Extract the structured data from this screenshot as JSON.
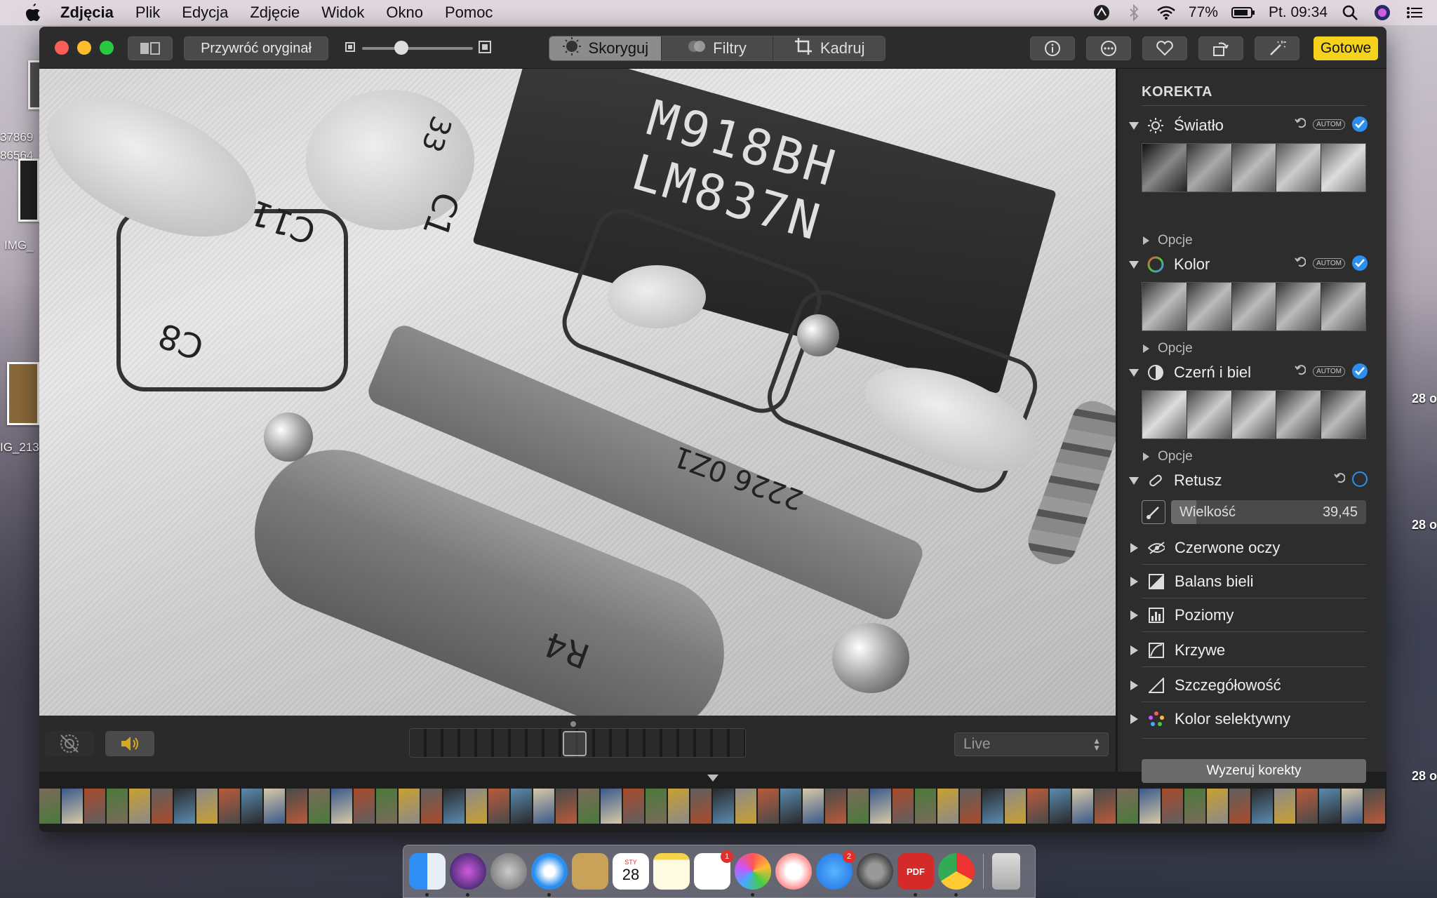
{
  "menubar": {
    "app_name": "Zdjęcia",
    "items": [
      "Plik",
      "Edycja",
      "Zdjęcie",
      "Widok",
      "Okno",
      "Pomoc"
    ],
    "battery": "77%",
    "clock": "Pt. 09:34"
  },
  "desktop": {
    "labels": [
      "37869",
      "86564",
      "IMG_",
      "IG_213"
    ],
    "right_labels": [
      "28 o",
      "28 o",
      "28 o"
    ]
  },
  "toolbar": {
    "revert_label": "Przywróć oryginał",
    "tabs": [
      {
        "label": "Skoryguj",
        "active": true,
        "icon": "adjust-icon"
      },
      {
        "label": "Filtry",
        "active": false,
        "icon": "filters-icon"
      },
      {
        "label": "Kadruj",
        "active": false,
        "icon": "crop-icon"
      }
    ],
    "done_label": "Gotowe"
  },
  "photo": {
    "chip_line1": "M918BH",
    "chip_line2": "LM837N",
    "silk_c8": "C8",
    "silk_r4": "R4",
    "silk_c11": "C11",
    "silk_c1": "C1",
    "resistor_text": "2226 0Z1",
    "cap_value": "33"
  },
  "video_bar": {
    "live_label": "Live"
  },
  "panel": {
    "title": "KOREKTA",
    "autom": "AUTOM",
    "options_label": "Opcje",
    "sections": [
      {
        "label": "Światło",
        "icon": "sun-icon",
        "expanded": true
      },
      {
        "label": "Kolor",
        "icon": "color-wheel-icon",
        "expanded": true
      },
      {
        "label": "Czerń i biel",
        "icon": "half-circle-icon",
        "expanded": true
      },
      {
        "label": "Retusz",
        "icon": "bandage-icon",
        "expanded": true
      }
    ],
    "retouch": {
      "size_label": "Wielkość",
      "size_value": "39,45"
    },
    "collapsed": [
      {
        "label": "Czerwone oczy",
        "icon": "red-eye-icon"
      },
      {
        "label": "Balans bieli",
        "icon": "white-balance-icon"
      },
      {
        "label": "Poziomy",
        "icon": "levels-icon"
      },
      {
        "label": "Krzywe",
        "icon": "curves-icon"
      },
      {
        "label": "Szczegółowość",
        "icon": "definition-icon"
      },
      {
        "label": "Kolor selektywny",
        "icon": "selective-color-icon"
      }
    ],
    "reset_label": "Wyzeruj korekty"
  },
  "dock": {
    "calendar_month": "STY",
    "calendar_day": "28",
    "reminders_badge": "1",
    "appstore_badge": "2",
    "pdf_label": "PDF"
  }
}
